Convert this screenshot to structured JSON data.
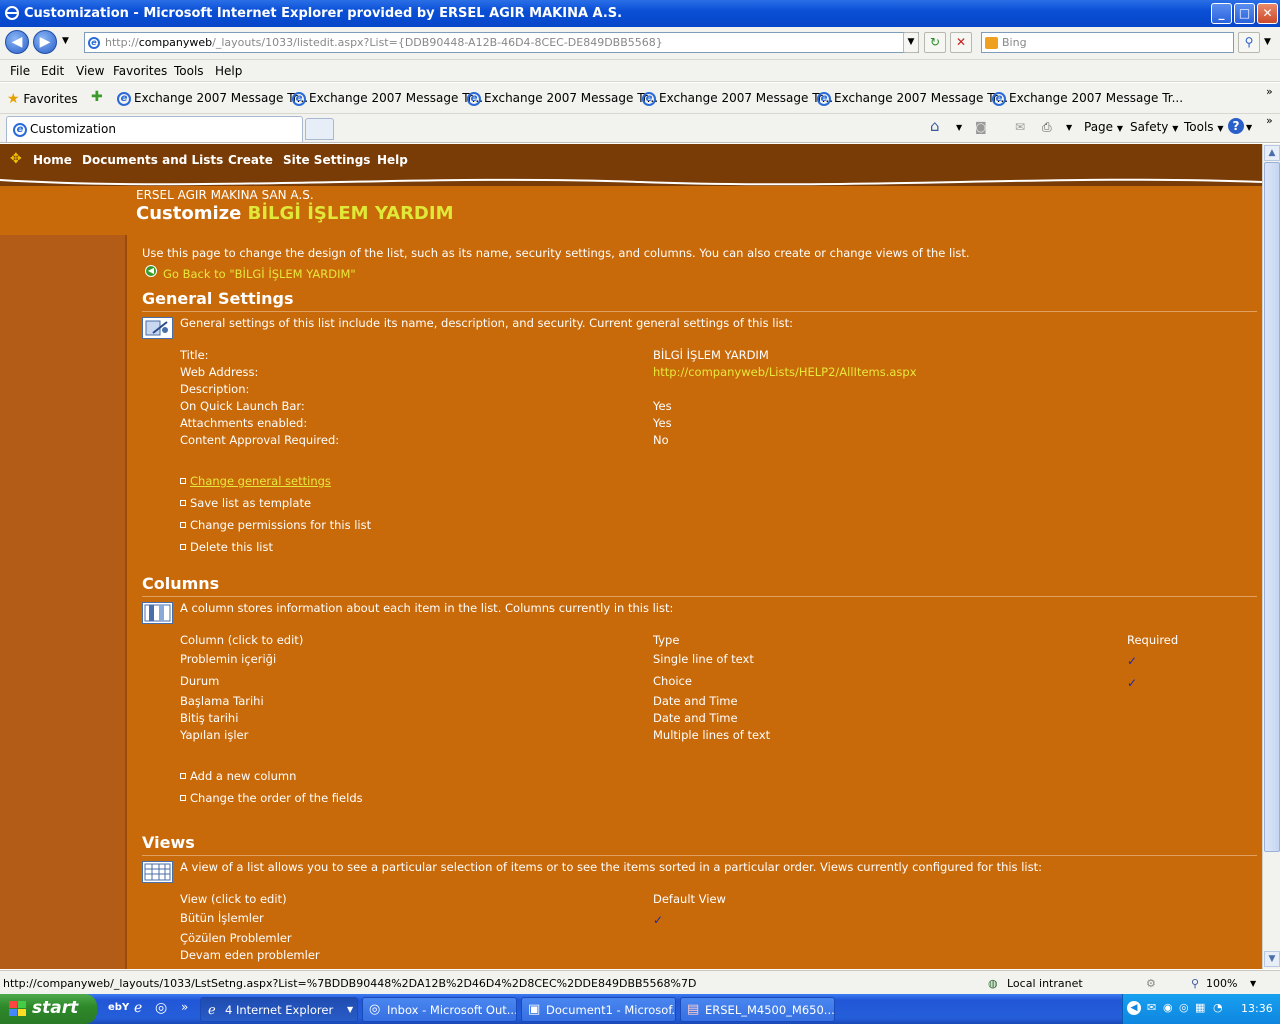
{
  "window": {
    "title": "Customization - Microsoft Internet Explorer provided by ERSEL AGIR MAKINA A.S.",
    "min": "_",
    "max": "□",
    "close": "✕"
  },
  "address": {
    "prefix": "http://",
    "host": "companyweb",
    "path": "/_layouts/1033/listedit.aspx?List={DDB90448-A12B-46D4-8CEC-DE849DBB5568}",
    "search_placeholder": "Bing"
  },
  "menu": [
    "File",
    "Edit",
    "View",
    "Favorites",
    "Tools",
    "Help"
  ],
  "favorites": {
    "label": "Favorites",
    "items": [
      "Exchange 2007 Message Tr...",
      "Exchange 2007 Message Tr...",
      "Exchange 2007 Message Tr...",
      "Exchange 2007 Message Tr...",
      "Exchange 2007 Message Tr...",
      "Exchange 2007 Message Tr..."
    ]
  },
  "tabs": {
    "active": "Customization"
  },
  "commandbar": {
    "page": "Page",
    "safety": "Safety",
    "tools": "Tools"
  },
  "topnav": [
    "Home",
    "Documents and Lists",
    "Create",
    "Site Settings",
    "Help"
  ],
  "site": {
    "org": "ERSEL AGIR MAKINA SAN A.S.",
    "title_prefix": "Customize ",
    "title_list": "BİLGİ İŞLEM YARDIM"
  },
  "intro": "Use this page to change the design of the list, such as its name, security settings, and columns. You can also create or change views of the list.",
  "goback": "Go Back to \"BİLGİ İŞLEM YARDIM\"",
  "general": {
    "heading": "General Settings",
    "desc": "General settings of this list include its name, description, and security. Current general settings of this list:",
    "rows": [
      {
        "label": "Title:",
        "value": "BİLGİ İŞLEM YARDIM"
      },
      {
        "label": "Web Address:",
        "value": "http://companyweb/Lists/HELP2/AllItems.aspx"
      },
      {
        "label": "Description:",
        "value": ""
      },
      {
        "label": "On Quick Launch Bar:",
        "value": "Yes"
      },
      {
        "label": "Attachments enabled:",
        "value": "Yes"
      },
      {
        "label": "Content Approval Required:",
        "value": "No"
      }
    ],
    "links": [
      "Change general settings",
      "Save list as template",
      "Change permissions for this list",
      "Delete this list"
    ]
  },
  "columns": {
    "heading": "Columns",
    "desc": "A column stores information about each item in the list. Columns currently in this list:",
    "headers": [
      "Column (click to edit)",
      "Type",
      "Required"
    ],
    "rows": [
      {
        "name": "Problemin içeriği",
        "type": "Single line of text",
        "required": "✓"
      },
      {
        "name": "Durum",
        "type": "Choice",
        "required": "✓"
      },
      {
        "name": "Başlama Tarihi",
        "type": "Date and Time",
        "required": ""
      },
      {
        "name": "Bitiş tarihi",
        "type": "Date and Time",
        "required": ""
      },
      {
        "name": "Yapılan işler",
        "type": "Multiple lines of text",
        "required": ""
      }
    ],
    "links": [
      "Add a new column",
      "Change the order of the fields"
    ]
  },
  "views": {
    "heading": "Views",
    "desc": "A view of a list allows you to see a particular selection of items or to see the items sorted in a particular order. Views currently configured for this list:",
    "headers": [
      "View (click to edit)",
      "Default View"
    ],
    "rows": [
      {
        "name": "Bütün İşlemler",
        "default": "✓"
      },
      {
        "name": "Çözülen Problemler",
        "default": ""
      },
      {
        "name": "Devam eden problemler",
        "default": ""
      }
    ]
  },
  "status": {
    "url": "http://companyweb/_layouts/1033/LstSetng.aspx?List=%7BDDB90448%2DA12B%2D46D4%2D8CEC%2DDE849DBB5568%7D",
    "zone": "Local intranet",
    "zoom": "100%"
  },
  "taskbar": {
    "start": "start",
    "tasks": [
      "4 Internet Explorer",
      "Inbox - Microsoft Out...",
      "Document1 - Microsof...",
      "ERSEL_M4500_M650..."
    ],
    "clock": "13:36"
  },
  "colors": {
    "page_bg": "#c8690a",
    "nav_bg": "#7a3c06",
    "link_yellow": "#e8e83c",
    "left_bar": "#b35c17"
  }
}
